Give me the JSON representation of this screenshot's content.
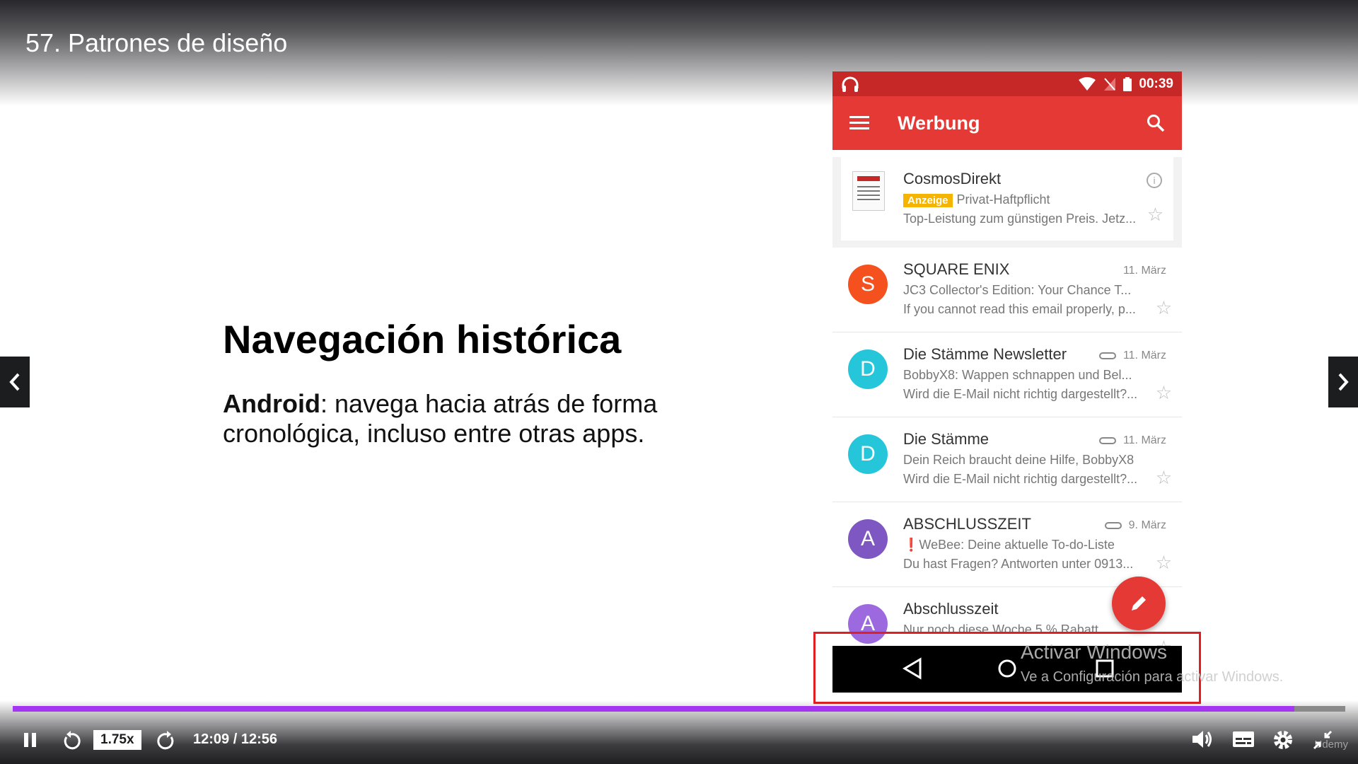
{
  "video": {
    "title": "57. Patrones de diseño"
  },
  "slide": {
    "heading": "Navegación histórica",
    "body_bold": "Android",
    "body_rest": ": navega hacia atrás de forma cronológica, incluso entre otras apps."
  },
  "phone": {
    "status_time": "00:39",
    "app_title": "Werbung",
    "ad": {
      "sender": "CosmosDirekt",
      "badge": "Anzeige",
      "subject": "Privat-Haftpflicht",
      "snippet": "Top-Leistung zum günstigen Preis. Jetz..."
    },
    "emails": [
      {
        "initial": "S",
        "color": "#f4511e",
        "sender": "SQUARE ENIX",
        "date": "11. März",
        "attachment": false,
        "subject": "JC3 Collector's Edition: Your Chance T...",
        "snippet": "If you cannot read this email properly, p..."
      },
      {
        "initial": "D",
        "color": "#26c6da",
        "sender": "Die Stämme Newsletter",
        "date": "11. März",
        "attachment": true,
        "subject": "BobbyX8: Wappen schnappen und Bel...",
        "snippet": "Wird die E-Mail nicht richtig dargestellt?..."
      },
      {
        "initial": "D",
        "color": "#26c6da",
        "sender": "Die Stämme",
        "date": "11. März",
        "attachment": true,
        "subject": "Dein Reich braucht deine Hilfe, BobbyX8",
        "snippet": "Wird die E-Mail nicht richtig dargestellt?..."
      },
      {
        "initial": "A",
        "color": "#7e57c2",
        "sender": "ABSCHLUSSZEIT",
        "date": "9. März",
        "attachment": true,
        "subject": "❗WeBee: Deine aktuelle To-do-Liste",
        "snippet": "Du hast Fragen? Antworten unter 0913..."
      },
      {
        "initial": "A",
        "color": "#9c6ade",
        "sender": "Abschlusszeit",
        "date": "",
        "attachment": false,
        "subject": "Nur noch diese Woche 5 % Rabatt",
        "snippet": ""
      }
    ]
  },
  "watermark": {
    "line1": "Activar Windows",
    "line2": "Ve a Configuración para activar Windows."
  },
  "player": {
    "speed": "1.75x",
    "time": "12:09 / 12:56",
    "progress": 0.962,
    "accent": "#a435f0",
    "brand": "Udemy"
  },
  "icons": [
    "pause-icon",
    "rewind-icon",
    "forward-icon",
    "volume-icon",
    "captions-icon",
    "settings-icon",
    "exit-fullscreen-icon"
  ]
}
